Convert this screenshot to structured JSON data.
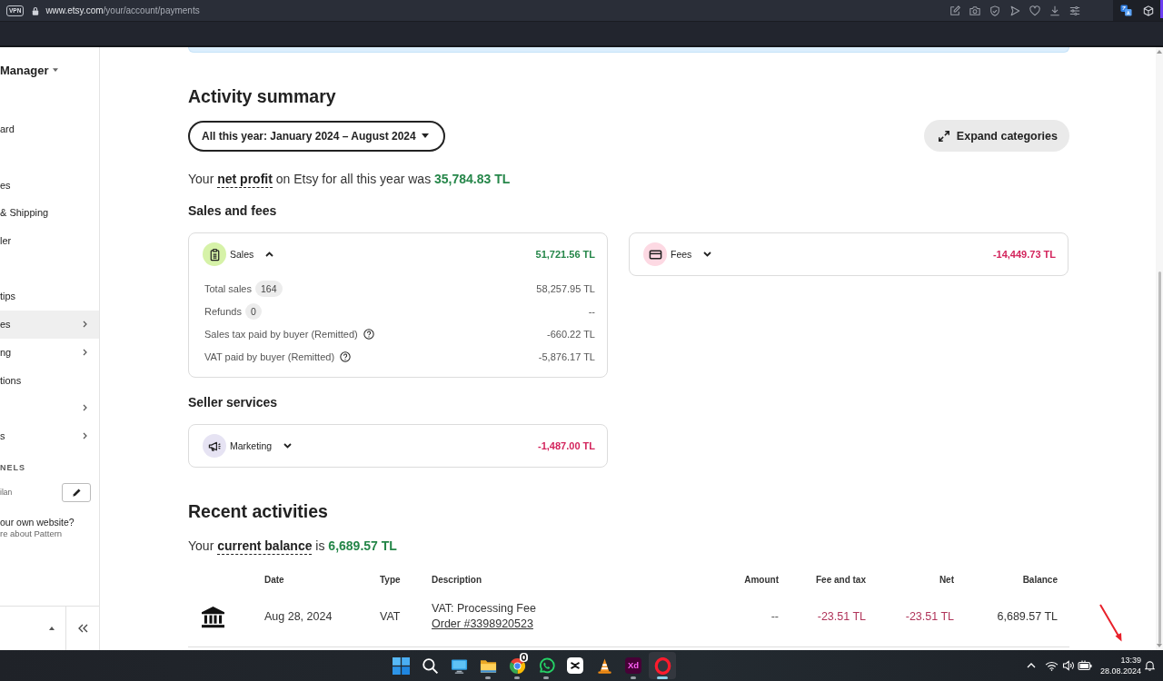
{
  "browser": {
    "vpn_label": "VPN",
    "url_host": "www.etsy.com",
    "url_path": "/your/account/payments"
  },
  "sidebar": {
    "title": "Manager",
    "items": [
      {
        "label": "ard",
        "submenu": false,
        "selected": false
      },
      {
        "submenu": false,
        "selected": false
      },
      {
        "label": "es",
        "submenu": false,
        "selected": false
      },
      {
        "label": "& Shipping",
        "submenu": false,
        "selected": false
      },
      {
        "label": "ler",
        "submenu": false,
        "selected": false
      },
      {
        "submenu": false,
        "selected": false
      },
      {
        "label": "tips",
        "submenu": false,
        "selected": false
      },
      {
        "label": "es",
        "submenu": true,
        "selected": true
      },
      {
        "label": "ng",
        "submenu": true,
        "selected": false
      },
      {
        "label": "tions",
        "submenu": false,
        "selected": false
      },
      {
        "submenu": true,
        "selected": false
      },
      {
        "label": "s",
        "submenu": true,
        "selected": false
      }
    ],
    "channels_heading": "NELS",
    "channel": "ilan",
    "promo_title": "our own website?",
    "promo_link": "re about Pattern"
  },
  "activity_summary": {
    "title": "Activity summary",
    "period_dropdown": "All this year: January 2024 – August 2024",
    "expand_button": "Expand categories",
    "profit_sentence": {
      "before": "Your",
      "term": "net profit",
      "after": "on Etsy for all this year was",
      "amount": "35,784.83 TL"
    },
    "sales_and_fees": {
      "title": "Sales and fees",
      "cards": [
        {
          "kind": "sales",
          "label": "Sales",
          "expanded": true,
          "total": "51,721.56 TL",
          "color": "#258649",
          "rows": [
            {
              "label": "Total sales",
              "count": "164",
              "value": "58,257.95 TL",
              "info": false
            },
            {
              "label": "Refunds",
              "count": "0",
              "value": "--",
              "info": false
            },
            {
              "label": "Sales tax paid by buyer (Remitted)",
              "value": "-660.22 TL",
              "info": true
            },
            {
              "label": "VAT paid by buyer (Remitted)",
              "value": "-5,876.17 TL",
              "info": true
            }
          ]
        },
        {
          "kind": "fees",
          "label": "Fees",
          "expanded": false,
          "total": "-14,449.73 TL",
          "color": "#d3245c"
        }
      ]
    },
    "seller_services": {
      "title": "Seller services",
      "cards": [
        {
          "kind": "marketing",
          "label": "Marketing",
          "expanded": false,
          "total": "-1,487.00 TL",
          "color": "#d3245c"
        }
      ]
    }
  },
  "recent_activities": {
    "title": "Recent activities",
    "balance_sentence": {
      "before": "Your",
      "term": "current balance",
      "after": "is",
      "amount": "6,689.57 TL"
    },
    "table": {
      "columns": [
        "Date",
        "Type",
        "Description",
        "Amount",
        "Fee and tax",
        "Net",
        "Balance"
      ],
      "rows": [
        {
          "kind": "bank",
          "date": "Aug 28, 2024",
          "type": "VAT",
          "description": "VAT: Processing Fee",
          "order_link": "Order #3398920523",
          "amount": "--",
          "fee_and_tax": "-23.51 TL",
          "net": "-23.51 TL",
          "balance": "6,689.57 TL"
        }
      ]
    }
  },
  "taskbar": {
    "apps": [
      {
        "kind": "start",
        "running": false,
        "selected": false
      },
      {
        "kind": "search",
        "running": false,
        "selected": false
      },
      {
        "kind": "monitor",
        "running": false,
        "selected": false
      },
      {
        "kind": "folder",
        "running": true,
        "selected": false
      },
      {
        "kind": "chrome",
        "running": true,
        "selected": false
      },
      {
        "kind": "chat",
        "running": true,
        "selected": false
      },
      {
        "kind": "tile",
        "running": false,
        "selected": false
      },
      {
        "kind": "cone",
        "running": false,
        "selected": false
      },
      {
        "kind": "xd",
        "label": "Xd",
        "running": true,
        "selected": false
      },
      {
        "kind": "ring",
        "running": true,
        "selected": true
      }
    ],
    "time": "13:39",
    "date": "28.08.2024"
  }
}
